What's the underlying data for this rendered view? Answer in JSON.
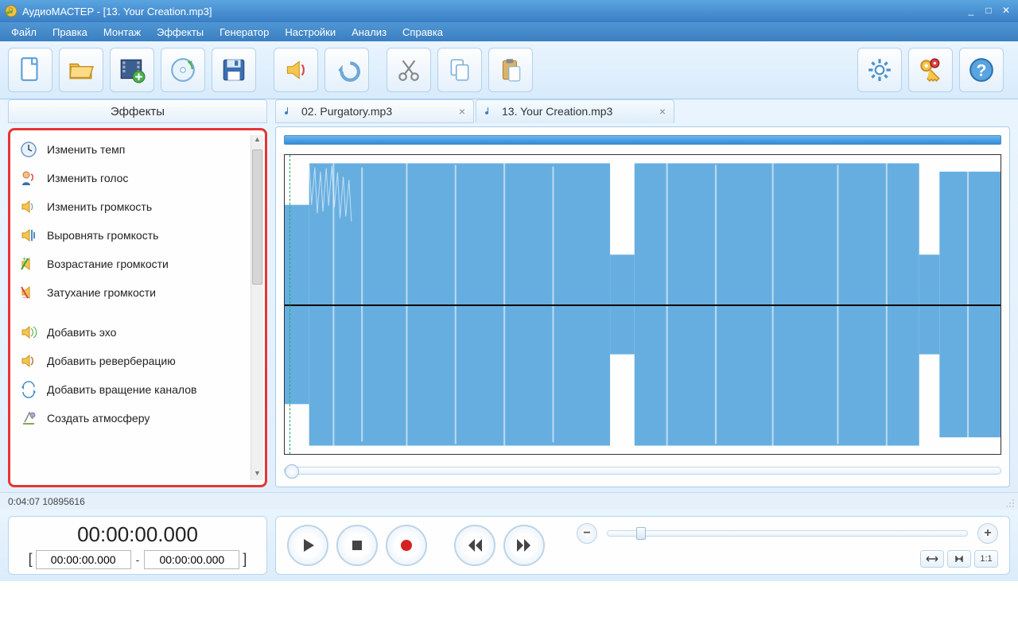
{
  "window": {
    "title": "АудиоМАСТЕР - [13. Your Creation.mp3]"
  },
  "menu": {
    "items": [
      "Файл",
      "Правка",
      "Монтаж",
      "Эффекты",
      "Генератор",
      "Настройки",
      "Анализ",
      "Справка"
    ]
  },
  "toolbar": {
    "new": "new",
    "open": "open",
    "import_video": "import-video",
    "cd": "cd-import",
    "save": "save",
    "voice_effect": "voice-effect",
    "undo": "undo",
    "cut": "cut",
    "copy": "copy",
    "paste": "paste",
    "settings": "settings",
    "keys": "license-keys",
    "help": "help"
  },
  "effects": {
    "header": "Эффекты",
    "items": [
      {
        "label": "Изменить темп",
        "icon": "clock"
      },
      {
        "label": "Изменить голос",
        "icon": "voice"
      },
      {
        "label": "Изменить громкость",
        "icon": "speaker"
      },
      {
        "label": "Выровнять громкость",
        "icon": "equalize"
      },
      {
        "label": "Возрастание громкости",
        "icon": "fadein"
      },
      {
        "label": "Затухание громкости",
        "icon": "fadeout"
      }
    ],
    "items2": [
      {
        "label": "Добавить эхо",
        "icon": "echo"
      },
      {
        "label": "Добавить реверберацию",
        "icon": "reverb"
      },
      {
        "label": "Добавить вращение каналов",
        "icon": "rotate"
      },
      {
        "label": "Создать атмосферу",
        "icon": "atmosphere"
      }
    ]
  },
  "tabs": [
    {
      "label": "02. Purgatory.mp3",
      "active": false
    },
    {
      "label": "13. Your Creation.mp3",
      "active": true
    }
  ],
  "status": {
    "text": "0:04:07 10895616"
  },
  "time": {
    "current": "00:00:00.000",
    "sel_start": "00:00:00.000",
    "sel_end": "00:00:00.000"
  },
  "view": {
    "ratio": "1:1"
  }
}
